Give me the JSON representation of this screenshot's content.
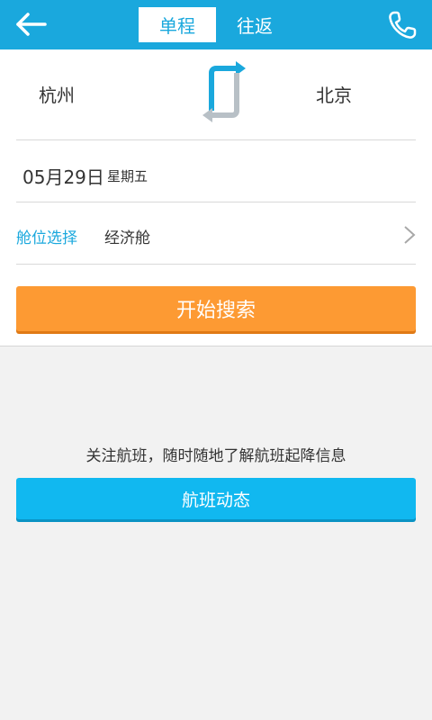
{
  "header": {
    "tabs": [
      {
        "label": "单程",
        "active": true
      },
      {
        "label": "往返",
        "active": false
      }
    ],
    "back_icon": "arrow-left-icon",
    "phone_icon": "phone-icon"
  },
  "route": {
    "from_city": "杭州",
    "to_city": "北京",
    "swap_icon": "swap-route-icon"
  },
  "date": {
    "value": "05月29日",
    "weekday": "星期五"
  },
  "cabin": {
    "label": "舱位选择",
    "value": "经济舱"
  },
  "search_button": "开始搜索",
  "flight_status": {
    "promo": "关注航班，随时随地了解航班起降信息",
    "button": "航班动态"
  },
  "colors": {
    "primary": "#1aa8dd",
    "search": "#fd9a33",
    "status": "#11b8f0",
    "background": "#f2f2f2"
  }
}
